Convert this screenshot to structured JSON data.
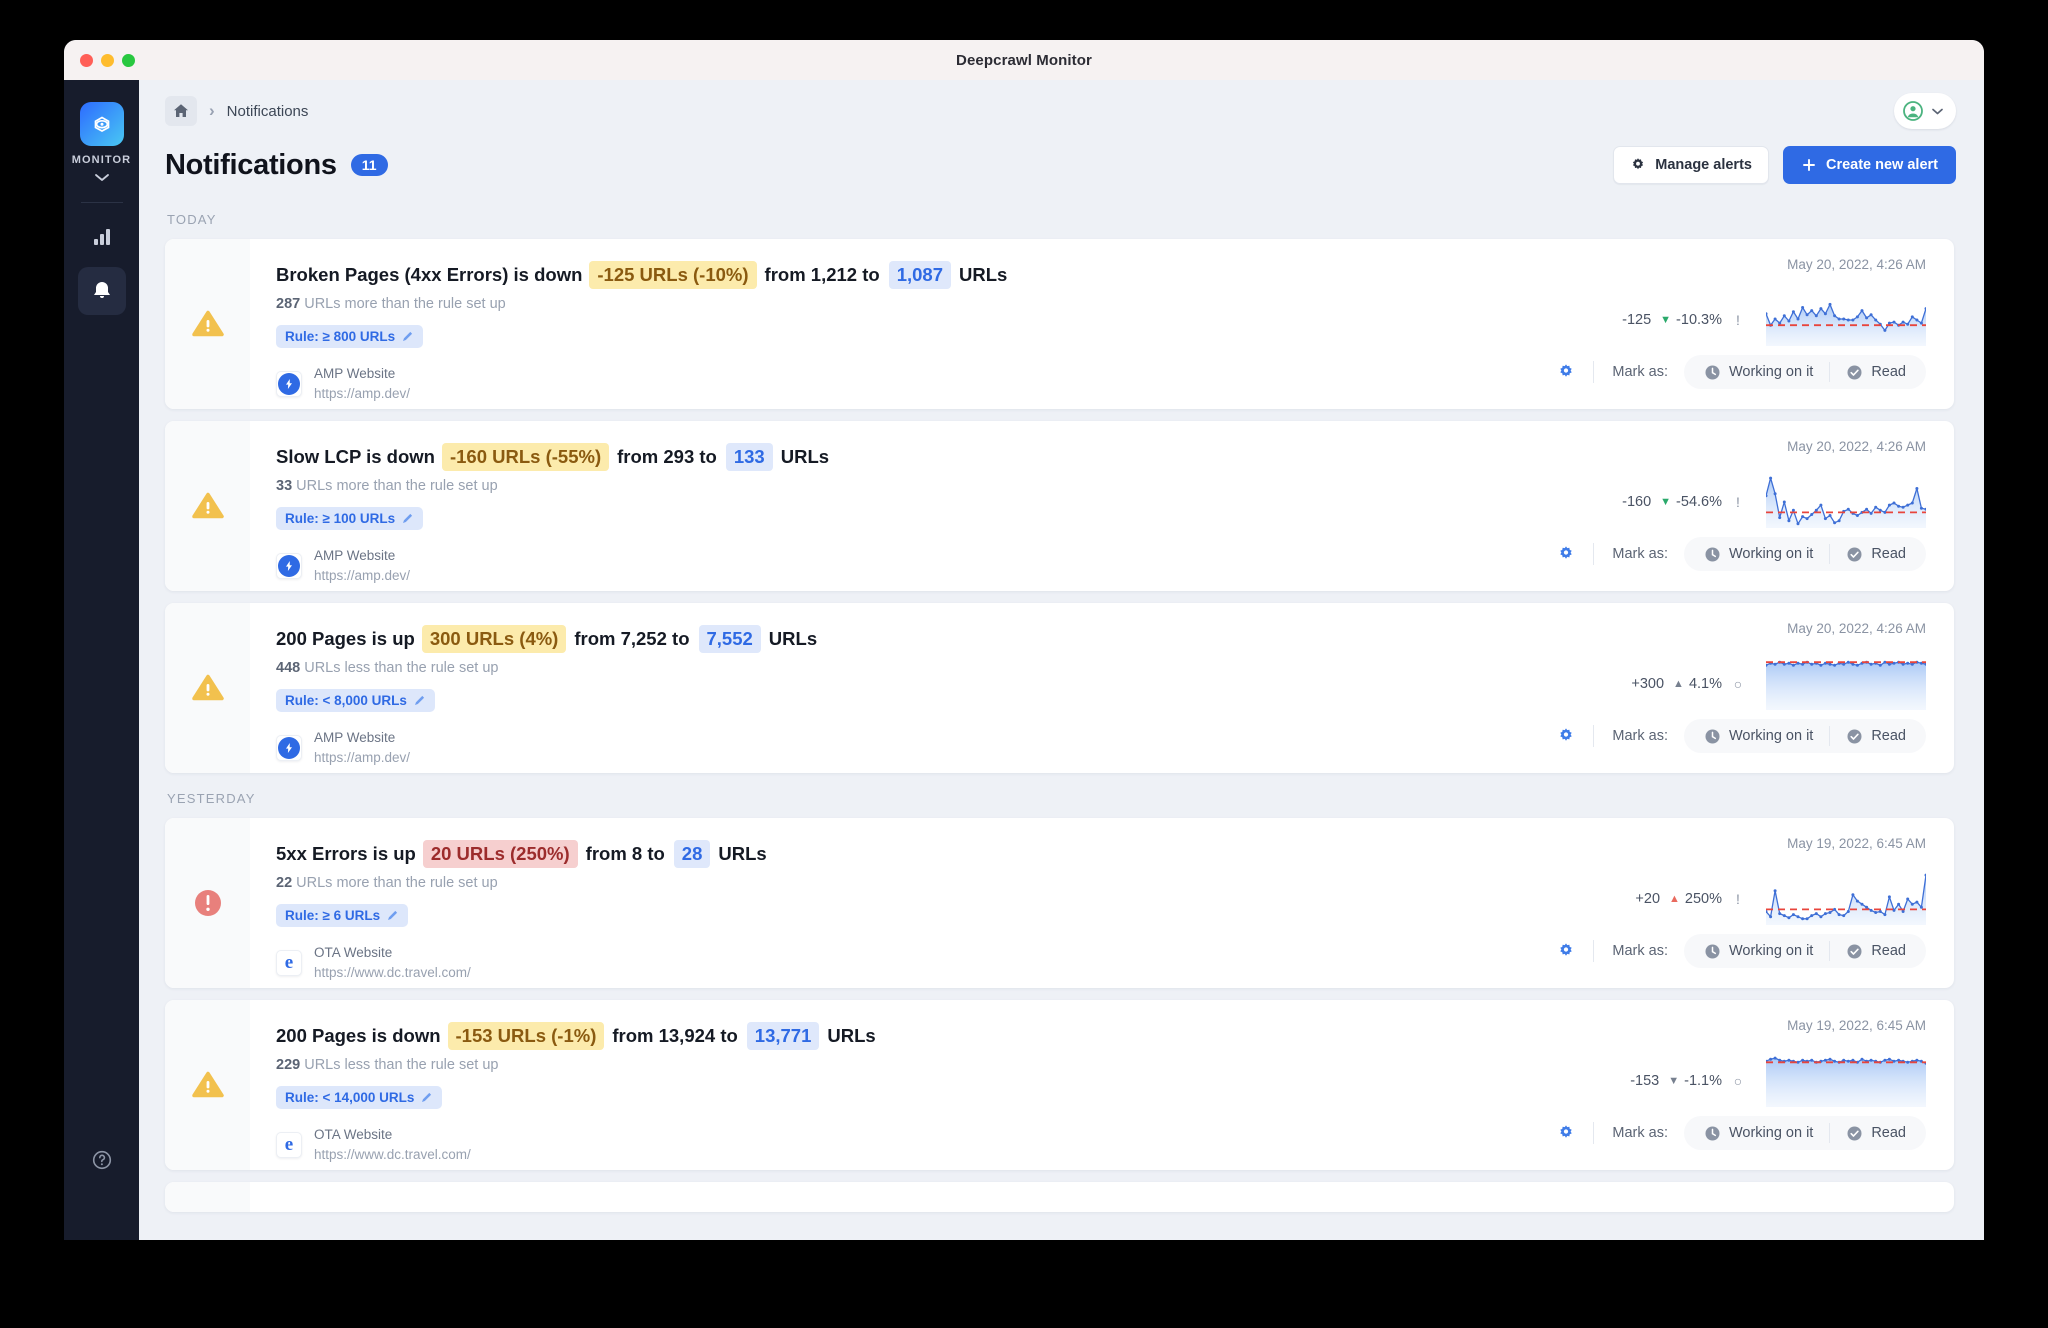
{
  "window": {
    "title": "Deepcrawl Monitor"
  },
  "sidebar": {
    "brand_label": "MONITOR",
    "items": [
      {
        "name": "reports",
        "icon": "bar-chart-icon"
      },
      {
        "name": "notifications",
        "icon": "bell-icon",
        "active": true
      }
    ],
    "help_icon": "help-circle-icon"
  },
  "topbar": {
    "home_icon": "home-icon",
    "separator": "›",
    "breadcrumb_current": "Notifications",
    "avatar_icon": "user-avatar-icon",
    "avatar_caret": "chevron-down-icon"
  },
  "header": {
    "title": "Notifications",
    "count": "11",
    "manage_alerts_label": "Manage alerts",
    "manage_alerts_icon": "gear-icon",
    "create_alert_label": "Create new alert",
    "create_alert_icon": "plus-icon"
  },
  "labels": {
    "mark_as": "Mark as:",
    "working_on_it": "Working on it",
    "read": "Read",
    "working_icon": "clock-icon",
    "read_icon": "check-circle-icon",
    "settings_icon": "gear-icon",
    "rule_edit_icon": "pencil-icon"
  },
  "colors": {
    "accent_blue": "#2f6ae4",
    "warn_yellow": "#fcebac",
    "warn_text": "#8a5a10",
    "crit_red_bg": "#f6cfcf",
    "crit_red_text": "#9c2c2c",
    "value_bg": "#dfe8fb",
    "sidebar_bg": "#171c2c",
    "page_bg": "#eef1f6",
    "down_green": "#2aa96b",
    "up_red": "#e96a5e"
  },
  "groups": [
    {
      "label": "TODAY",
      "items": [
        {
          "severity": "warning",
          "title_prefix": "Broken Pages (4xx Errors) is down",
          "delta_pill": "-125 URLs (-10%)",
          "delta_kind": "warn",
          "from_text": "from 1,212 to",
          "to_value": "1,087",
          "suffix": "URLs",
          "sub_count": "287",
          "sub_text": "URLs more than the rule set up",
          "rule": "Rule: ≥ 800 URLs",
          "site_name": "AMP Website",
          "site_url": "https://amp.dev/",
          "site_icon": "amp-icon",
          "timestamp": "May 20, 2022, 4:26 AM",
          "metric_delta": "-125",
          "metric_arrow": "▼",
          "metric_arrow_kind": "down",
          "metric_pct": "-10.3%",
          "metric_flag": "!",
          "chart_index": 0
        },
        {
          "severity": "warning",
          "title_prefix": "Slow LCP is down",
          "delta_pill": "-160 URLs (-55%)",
          "delta_kind": "warn",
          "from_text": "from 293 to",
          "to_value": "133",
          "suffix": "URLs",
          "sub_count": "33",
          "sub_text": "URLs more than the rule set up",
          "rule": "Rule: ≥ 100 URLs",
          "site_name": "AMP Website",
          "site_url": "https://amp.dev/",
          "site_icon": "amp-icon",
          "timestamp": "May 20, 2022, 4:26 AM",
          "metric_delta": "-160",
          "metric_arrow": "▼",
          "metric_arrow_kind": "down",
          "metric_pct": "-54.6%",
          "metric_flag": "!",
          "chart_index": 1
        },
        {
          "severity": "warning",
          "title_prefix": "200 Pages is up",
          "delta_pill": "300 URLs (4%)",
          "delta_kind": "warn",
          "from_text": "from 7,252 to",
          "to_value": "7,552",
          "suffix": "URLs",
          "sub_count": "448",
          "sub_text": "URLs less than the rule set up",
          "rule": "Rule: < 8,000 URLs",
          "site_name": "AMP Website",
          "site_url": "https://amp.dev/",
          "site_icon": "amp-icon",
          "timestamp": "May 20, 2022, 4:26 AM",
          "metric_delta": "+300",
          "metric_arrow": "▲",
          "metric_arrow_kind": "neutral",
          "metric_pct": "4.1%",
          "metric_flag": "○",
          "chart_index": 2
        }
      ]
    },
    {
      "label": "YESTERDAY",
      "items": [
        {
          "severity": "critical",
          "title_prefix": "5xx Errors is up",
          "delta_pill": "20 URLs (250%)",
          "delta_kind": "crit",
          "from_text": "from 8 to",
          "to_value": "28",
          "suffix": "URLs",
          "sub_count": "22",
          "sub_text": "URLs more than the rule set up",
          "rule": "Rule: ≥ 6 URLs",
          "site_name": "OTA Website",
          "site_url": "https://www.dc.travel.com/",
          "site_icon": "ota-e-icon",
          "timestamp": "May 19, 2022, 6:45 AM",
          "metric_delta": "+20",
          "metric_arrow": "▲",
          "metric_arrow_kind": "up-crit",
          "metric_pct": "250%",
          "metric_flag": "!",
          "chart_index": 3
        },
        {
          "severity": "warning",
          "title_prefix": "200 Pages is down",
          "delta_pill": "-153 URLs (-1%)",
          "delta_kind": "warn",
          "from_text": "from 13,924 to",
          "to_value": "13,771",
          "suffix": "URLs",
          "sub_count": "229",
          "sub_text": "URLs less than the rule set up",
          "rule": "Rule: < 14,000 URLs",
          "site_name": "OTA Website",
          "site_url": "https://www.dc.travel.com/",
          "site_icon": "ota-e-icon",
          "timestamp": "May 19, 2022, 6:45 AM",
          "metric_delta": "-153",
          "metric_arrow": "▼",
          "metric_arrow_kind": "neutral",
          "metric_pct": "-1.1%",
          "metric_flag": "○",
          "chart_index": 4
        }
      ]
    }
  ],
  "chart_data": [
    {
      "type": "area",
      "title": "Broken Pages (4xx Errors) trend",
      "series": [
        {
          "name": "URLs",
          "values": [
            62,
            40,
            52,
            44,
            58,
            48,
            66,
            52,
            74,
            60,
            68,
            58,
            72,
            62,
            80,
            58,
            52,
            52,
            50,
            50,
            56,
            68,
            54,
            60,
            50,
            42,
            30,
            44,
            46,
            40,
            46,
            42,
            56,
            50,
            44,
            72
          ]
        }
      ],
      "threshold": {
        "name": "Rule: ≥ 800 URLs",
        "value": 40,
        "style": "dashed-red"
      },
      "ylim": [
        0,
        100
      ],
      "grid": false,
      "legend": null
    },
    {
      "type": "area",
      "title": "Slow LCP trend",
      "series": [
        {
          "name": "URLs",
          "values": [
            62,
            96,
            66,
            20,
            50,
            14,
            34,
            8,
            22,
            18,
            26,
            34,
            44,
            18,
            24,
            10,
            14,
            32,
            36,
            28,
            24,
            30,
            36,
            28,
            40,
            34,
            30,
            44,
            48,
            42,
            40,
            44,
            48,
            76,
            38,
            36
          ]
        }
      ],
      "threshold": {
        "name": "Rule: ≥ 100 URLs",
        "value": 30,
        "style": "dashed-red"
      },
      "ylim": [
        0,
        100
      ],
      "grid": false,
      "legend": null
    },
    {
      "type": "area",
      "title": "200 Pages (AMP) trend",
      "series": [
        {
          "name": "URLs",
          "values": [
            86,
            90,
            88,
            92,
            88,
            90,
            86,
            90,
            88,
            92,
            88,
            90,
            86,
            90,
            88,
            86,
            90,
            88,
            92,
            88,
            86,
            90,
            92,
            88,
            90,
            86,
            92,
            88,
            90,
            92,
            88,
            90,
            88,
            92,
            90,
            88
          ]
        }
      ],
      "threshold": {
        "name": "Rule: < 8,000 URLs",
        "value": 92,
        "style": "dashed-red"
      },
      "ylim": [
        0,
        100
      ],
      "grid": false,
      "legend": null
    },
    {
      "type": "area",
      "title": "5xx Errors trend",
      "series": [
        {
          "name": "URLs",
          "values": [
            26,
            16,
            66,
            22,
            18,
            14,
            20,
            16,
            12,
            12,
            18,
            22,
            16,
            22,
            24,
            30,
            20,
            18,
            26,
            58,
            46,
            40,
            34,
            28,
            24,
            26,
            20,
            54,
            28,
            40,
            26,
            50,
            40,
            44,
            34,
            96
          ]
        }
      ],
      "threshold": {
        "name": "Rule: ≥ 6 URLs",
        "value": 30,
        "style": "dashed-red"
      },
      "ylim": [
        0,
        100
      ],
      "grid": false,
      "legend": null
    },
    {
      "type": "area",
      "title": "200 Pages (OTA) trend",
      "series": [
        {
          "name": "URLs",
          "values": [
            88,
            92,
            94,
            90,
            88,
            90,
            88,
            86,
            90,
            88,
            90,
            86,
            88,
            90,
            92,
            88,
            86,
            90,
            88,
            90,
            86,
            92,
            88,
            90,
            88,
            86,
            90,
            92,
            88,
            90,
            88,
            86,
            88,
            90,
            88,
            84
          ]
        }
      ],
      "threshold": {
        "name": "Rule: < 14,000 URLs",
        "value": 86,
        "style": "dashed-red"
      },
      "ylim": [
        0,
        100
      ],
      "grid": false,
      "legend": null
    }
  ]
}
